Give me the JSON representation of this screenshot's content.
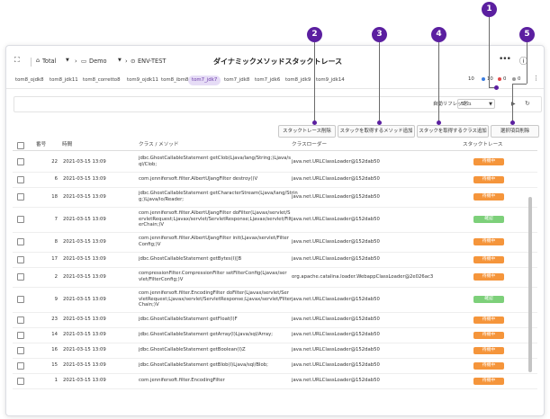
{
  "header": {
    "title": "ダイナミックメソッドスタックトレース",
    "total_label": "Total",
    "demo_label": "Demo",
    "env_label": "ENV-TEST",
    "more_icon": "more-icon",
    "help_icon": "help-icon"
  },
  "tabs": [
    "tom8_ojdk8",
    "tom8_jdk11",
    "tom8_corretto8",
    "tom9_ojdk11",
    "tom8_ibm8",
    "tom7_jdk7",
    "tom7_jdk8",
    "tom7_jdk6",
    "tom8_jdk9",
    "tom9_jdk14"
  ],
  "status": {
    "count": "10",
    "blue": "10",
    "red": "0",
    "gray": "0"
  },
  "toolbar": {
    "refresh_label": "自動リフレッシュ",
    "refresh_value": "5秒"
  },
  "buttons": {
    "delete_trace": "スタックトレース削除",
    "add_method": "スタックを取得するメソッド追加",
    "add_class": "スタックを取得するクラス追加",
    "delete_selected": "選択項目削除"
  },
  "table": {
    "columns": [
      "番号",
      "時間",
      "クラス / メソッド",
      "クラスローダー",
      "スタックトレース"
    ],
    "rows": [
      {
        "no": "22",
        "time": "2021-03-15 13:09",
        "method": "jdbc.GhostCallableStatement getClob(Ljava/lang/String;)Ljava/s\nql/Clob;",
        "loader": "java.net.URLClassLoader@152dab50",
        "status": "待機中",
        "kind": "wait"
      },
      {
        "no": "6",
        "time": "2021-03-15 13:09",
        "method": "com.jennifersoft.filter.AlbertUJangFilter destroy()V",
        "loader": "java.net.URLClassLoader@152dab50",
        "status": "待機中",
        "kind": "wait"
      },
      {
        "no": "18",
        "time": "2021-03-15 13:09",
        "method": "jdbc.GhostCallableStatement getCharacterStream(Ljava/lang/Strin\ng;)Ljava/io/Reader;",
        "loader": "java.net.URLClassLoader@152dab50",
        "status": "待機中",
        "kind": "wait"
      },
      {
        "no": "7",
        "time": "2021-03-15 13:09",
        "method": "com.jennifersoft.filter.AlbertUJangFilter doFilter(Ljavax/servlet/S\nervletRequest;Ljavax/servlet/ServletResponse;Ljavax/servlet/Filt\nerChain;)V",
        "loader": "java.net.URLClassLoader@152dab50",
        "status": "確認",
        "kind": "ok"
      },
      {
        "no": "8",
        "time": "2021-03-15 13:09",
        "method": "com.jennifersoft.filter.AlbertUJangFilter init(Ljavax/servlet/Filter\nConfig;)V",
        "loader": "java.net.URLClassLoader@152dab50",
        "status": "待機中",
        "kind": "wait"
      },
      {
        "no": "17",
        "time": "2021-03-15 13:09",
        "method": "jdbc.GhostCallableStatement getBytes(I)[B",
        "loader": "java.net.URLClassLoader@152dab50",
        "status": "待機中",
        "kind": "wait"
      },
      {
        "no": "2",
        "time": "2021-03-15 13:09",
        "method": "compressionFilter.CompressionFilter setFilterConfig(Ljavax/ser\nvlet/FilterConfig;)V",
        "loader": "org.apache.catalina.loader.WebappClassLoader@2e026ac3",
        "status": "待機中",
        "kind": "wait"
      },
      {
        "no": "9",
        "time": "2021-03-15 13:09",
        "method": "com.jennifersoft.filter.EncodingFilter doFilter(Ljavax/servlet/Ser\nvletRequest;Ljavax/servlet/ServletResponse;Ljavax/servlet/Filter\nChain;)V",
        "loader": "java.net.URLClassLoader@152dab50",
        "status": "確認",
        "kind": "ok"
      },
      {
        "no": "23",
        "time": "2021-03-15 13:09",
        "method": "jdbc.GhostCallableStatement getFloat(I)F",
        "loader": "java.net.URLClassLoader@152dab50",
        "status": "待機中",
        "kind": "wait"
      },
      {
        "no": "14",
        "time": "2021-03-15 13:09",
        "method": "jdbc.GhostCallableStatement getArray(I)Ljava/sql/Array;",
        "loader": "java.net.URLClassLoader@152dab50",
        "status": "待機中",
        "kind": "wait"
      },
      {
        "no": "16",
        "time": "2021-03-15 13:09",
        "method": "jdbc.GhostCallableStatement getBoolean(I)Z",
        "loader": "java.net.URLClassLoader@152dab50",
        "status": "待機中",
        "kind": "wait"
      },
      {
        "no": "15",
        "time": "2021-03-15 13:09",
        "method": "jdbc.GhostCallableStatement getBlob(I)Ljava/sql/Blob;",
        "loader": "java.net.URLClassLoader@152dab50",
        "status": "待機中",
        "kind": "wait"
      },
      {
        "no": "1",
        "time": "2021-03-15 13:09",
        "method": "com.jennifersoft.filter.EncodingFilter",
        "loader": "java.net.URLClassLoader@152dab50",
        "status": "待機中",
        "kind": "wait"
      }
    ]
  },
  "callouts": [
    "1",
    "2",
    "3",
    "4",
    "5"
  ],
  "colors": {
    "wait": "#f5953b",
    "ok": "#7dd07a",
    "accent": "#5b1fa0",
    "tab_active": "#e6dcf6"
  }
}
